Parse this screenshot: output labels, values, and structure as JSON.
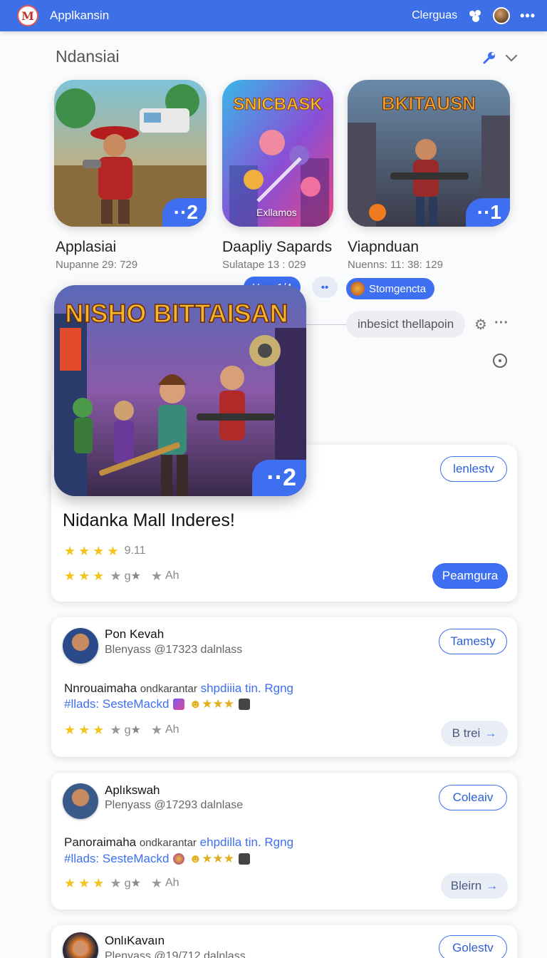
{
  "header": {
    "logo_text": "M",
    "app_title": "Applkansin",
    "nav_link": "Clerguas",
    "menu_dots": "•••"
  },
  "section": {
    "title": "Ndansiai"
  },
  "games": [
    {
      "name": "Applasiai",
      "meta": "Nupanne 29: 729",
      "badge": "··2"
    },
    {
      "name": "Daapliy Sapards",
      "meta": "Sulatape 13 : 029",
      "badge": "",
      "caption": "Exllamos",
      "logo": "SNICBASK"
    },
    {
      "name": "Viapnduan",
      "meta": "Nuenns: 11: 38: 129",
      "badge": "··1",
      "logo": "BKITAUSN"
    }
  ],
  "pills": {
    "update": "Uoc: 1/4",
    "more": "••",
    "strategy": "Stomgencta",
    "inline_search": "inbesict thellapoin"
  },
  "featured": {
    "logo": "NISHO BITTAISAN",
    "badge": "··2",
    "title": "Nidanka Mall Inderes!",
    "rating_value": "9.11",
    "sub_rating_a": "g★",
    "sub_rating_b": "Ah",
    "outline_button": "lenlestv",
    "primary_button": "Peamgura"
  },
  "reviews": [
    {
      "name": "Pon Kevah",
      "meta": "Blenyass @17323  dalnlass",
      "line_main": "Nnrouaimaha",
      "line_sub": "ondkarantar",
      "line_link": "shpdiiia tin. Rgng",
      "tag": "#llads: SesteMackd",
      "sub_rating_a": "g★",
      "sub_rating_b": "Ah",
      "follow_button": "Tamesty",
      "action_button": "B trei"
    },
    {
      "name": "Aplıkswah",
      "meta": "Plenyass @17293  dalnlase",
      "line_main": "Panoraimaha",
      "line_sub": "ondkarantar",
      "line_link": "ehpdilla tin. Rgng",
      "tag": "#llads: SesteMackd",
      "sub_rating_a": "g★",
      "sub_rating_b": "Ah",
      "follow_button": "Coleaiv",
      "action_button": "Bleirn"
    },
    {
      "name": "OnlıKavaın",
      "meta": "Plenyass @19/712  dalnlass",
      "follow_button": "Golestv"
    }
  ]
}
